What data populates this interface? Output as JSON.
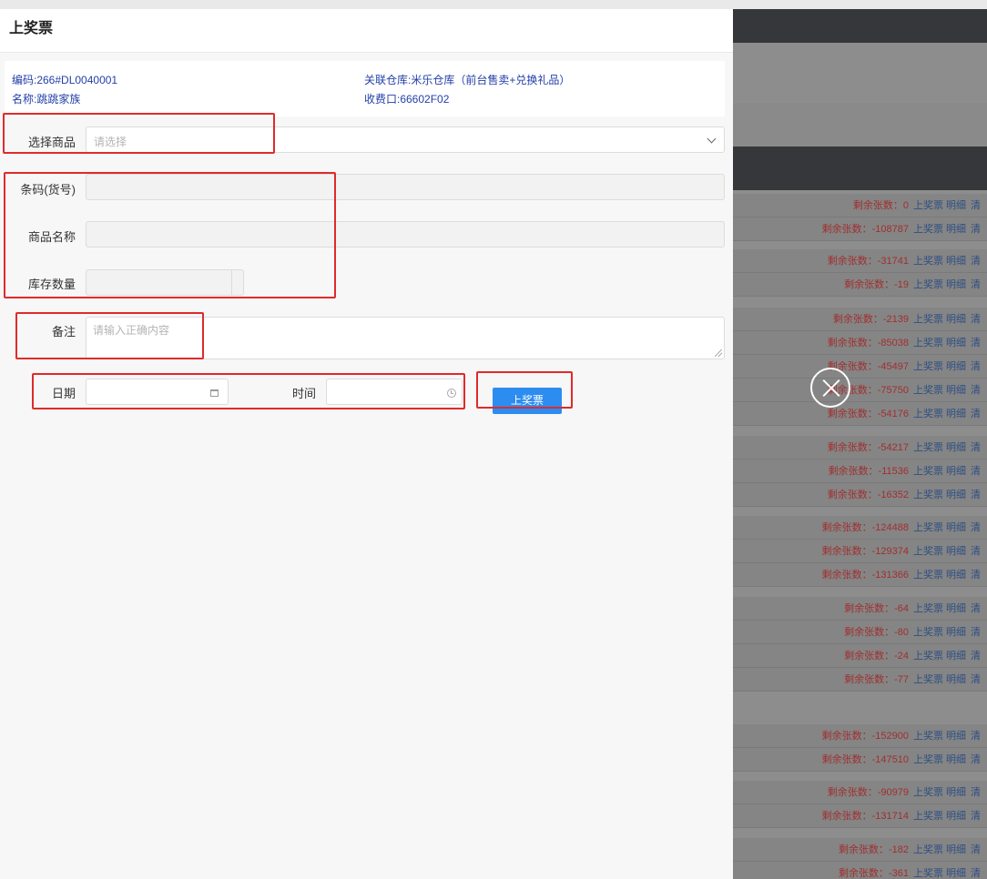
{
  "drawer": {
    "title": "上奖票",
    "info": {
      "code": "编码:266#DL0040001",
      "name": "名称:跳跳家族",
      "warehouse": "关联仓库:米乐仓库（前台售卖+兑换礼品）",
      "cashier": "收费口:66602F02"
    },
    "form": {
      "select_product": {
        "label": "选择商品",
        "placeholder": "请选择"
      },
      "barcode": {
        "label": "条码(货号)",
        "value": ""
      },
      "product_name": {
        "label": "商品名称",
        "value": ""
      },
      "stock_qty": {
        "label": "库存数量",
        "value": ""
      },
      "remark": {
        "label": "备注",
        "placeholder": "请输入正确内容"
      },
      "date": {
        "label": "日期",
        "value": ""
      },
      "time": {
        "label": "时间",
        "value": ""
      },
      "submit_label": "上奖票"
    }
  },
  "background_list": {
    "rows": [
      {
        "remaining": "剩余张数：0"
      },
      {
        "remaining": "剩余张数：-108787"
      },
      {
        "remaining": "剩余张数：-31741"
      },
      {
        "remaining": "剩余张数：-19"
      },
      {
        "remaining": "剩余张数：-2139"
      },
      {
        "remaining": "剩余张数：-85038"
      },
      {
        "remaining": "剩余张数：-45497"
      },
      {
        "remaining": "剩余张数：-75750"
      },
      {
        "remaining": "剩余张数：-54176"
      },
      {
        "remaining": "剩余张数：-54217"
      },
      {
        "remaining": "剩余张数：-11536"
      },
      {
        "remaining": "剩余张数：-16352"
      },
      {
        "remaining": "剩余张数：-124488"
      },
      {
        "remaining": "剩余张数：-129374"
      },
      {
        "remaining": "剩余张数：-131366"
      },
      {
        "remaining": "剩余张数：-64"
      },
      {
        "remaining": "剩余张数：-80"
      },
      {
        "remaining": "剩余张数：-24"
      },
      {
        "remaining": "剩余张数：-77"
      },
      {
        "remaining": "剩余张数：-152900"
      },
      {
        "remaining": "剩余张数：-147510"
      },
      {
        "remaining": "剩余张数：-90979"
      },
      {
        "remaining": "剩余张数：-131714"
      },
      {
        "remaining": "剩余张数：-182"
      },
      {
        "remaining": "剩余张数：-361"
      }
    ],
    "action_upload": "上奖票",
    "action_detail": "明细",
    "action_clear": "清"
  },
  "colors": {
    "accent": "#2d8cf0",
    "highlight": "#e02a2a",
    "info_text": "#2340a8",
    "remaining_text": "#a12f2f"
  }
}
